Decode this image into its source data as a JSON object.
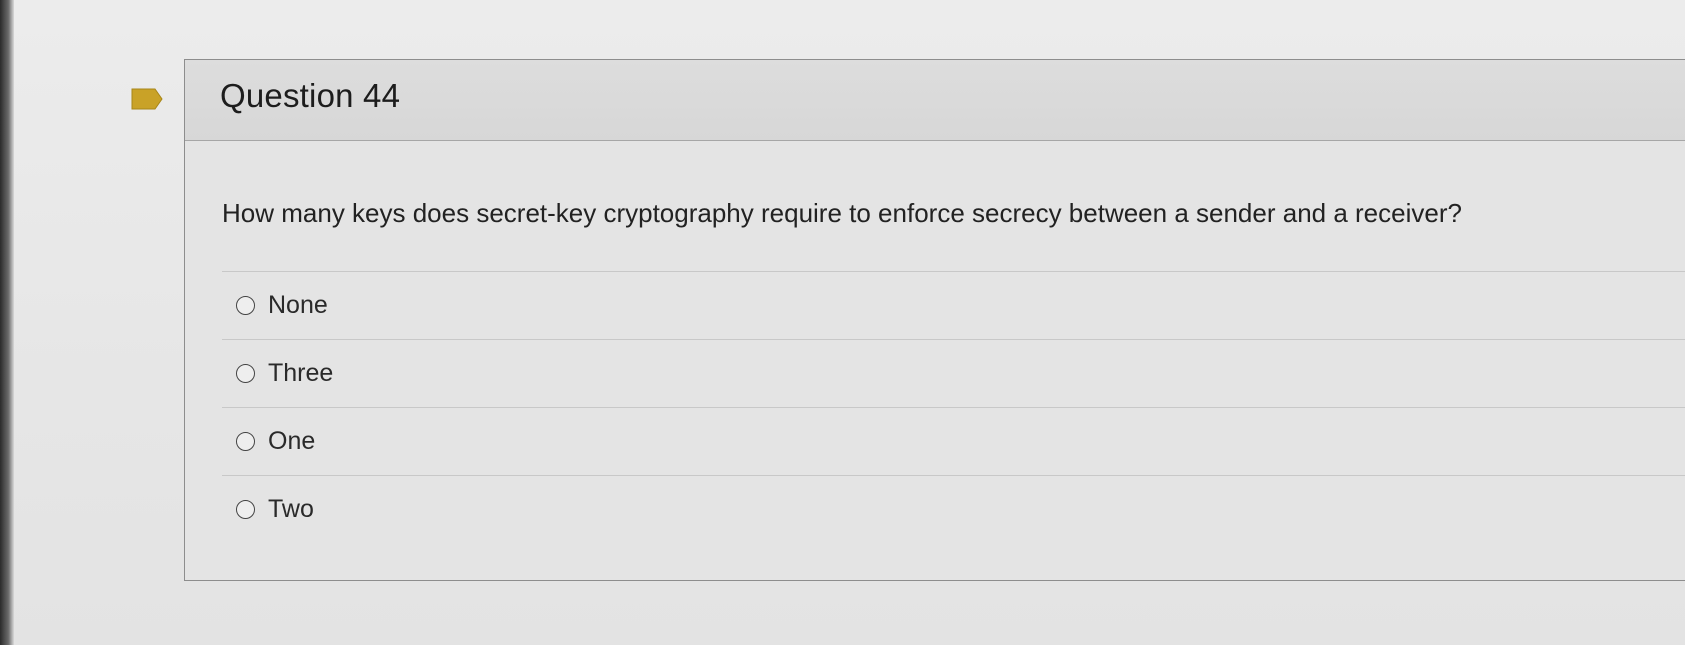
{
  "question": {
    "title": "Question 44",
    "prompt": "How many keys does secret-key cryptography require to enforce secrecy between a sender and a receiver?",
    "flag_icon": "flag-icon",
    "flag_color": "#c9a227",
    "options": [
      {
        "label": "None"
      },
      {
        "label": "Three"
      },
      {
        "label": "One"
      },
      {
        "label": "Two"
      }
    ]
  }
}
